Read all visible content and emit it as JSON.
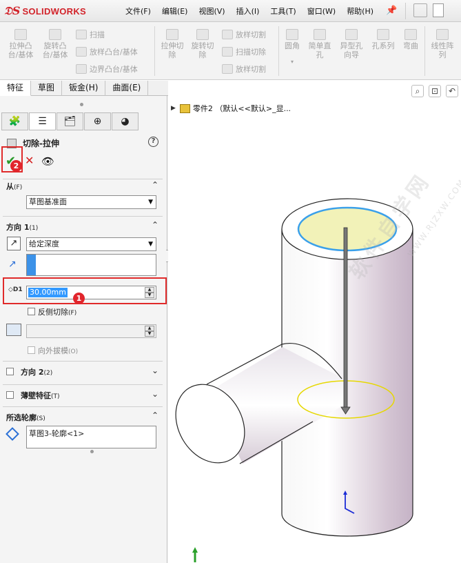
{
  "app": {
    "logo_ds": "𝔇S",
    "logo_name": "SOLIDWORKS"
  },
  "menu": [
    {
      "label": "文件(F)"
    },
    {
      "label": "编辑(E)"
    },
    {
      "label": "视图(V)"
    },
    {
      "label": "插入(I)"
    },
    {
      "label": "工具(T)"
    },
    {
      "label": "窗口(W)"
    },
    {
      "label": "帮助(H)"
    }
  ],
  "ribbon": {
    "extrude_boss": "拉伸凸\n台/基体",
    "revolve_boss": "旋转凸\n台/基体",
    "sweep": "扫描",
    "loft_boss": "放样凸台/基体",
    "boundary_boss": "边界凸台/基体",
    "extrude_cut": "拉伸切\n除",
    "revolve_cut": "旋转切\n除",
    "loft_cut": "放样切割",
    "sweep_cut": "扫描切除",
    "loft_cut2": "放样切割",
    "fillet": "圆角",
    "simple_hole": "简单直\n孔",
    "hole_wizard": "异型孔\n向导",
    "hole_series": "孔系列",
    "bend": "弯曲",
    "linear_pattern": "线性阵\n列"
  },
  "cm_tabs": [
    {
      "label": "特征"
    },
    {
      "label": "草图"
    },
    {
      "label": "钣金(H)"
    },
    {
      "label": "曲面(E)"
    }
  ],
  "pm": {
    "title": "切除-拉伸",
    "help": "?",
    "from": {
      "header": "从",
      "hint": "(F)",
      "value": "草图基准面"
    },
    "direction1": {
      "header": "方向 1",
      "hint": "(1)",
      "end_condition": "给定深度",
      "depth": "30.00mm",
      "flip_side": "反侧切除",
      "flip_side_hint": "(F)",
      "draft_outward": "向外拔模",
      "draft_outward_hint": "(O)"
    },
    "direction2": {
      "header": "方向 2",
      "hint": "(2)"
    },
    "thin_feature": {
      "header": "薄壁特征",
      "hint": "(T)"
    },
    "selected_contours": {
      "header": "所选轮廓",
      "hint": "(S)",
      "items": [
        "草图3-轮廓<1>"
      ]
    }
  },
  "badges": {
    "ok": "2",
    "depth": "1"
  },
  "tree": {
    "root": "零件2 （默认<<默认>_显..."
  },
  "watermark": {
    "cn": "软件自学网",
    "url": "WWW.RJZXW.COM"
  },
  "colors": {
    "highlight_red": "#e02a2a",
    "badge_red": "#e1252c",
    "ok_green": "#2a9a2a",
    "selection_blue": "#3399ff",
    "cap_yellow": "#f0f0b8",
    "rim_blue": "#3aa0ea"
  }
}
